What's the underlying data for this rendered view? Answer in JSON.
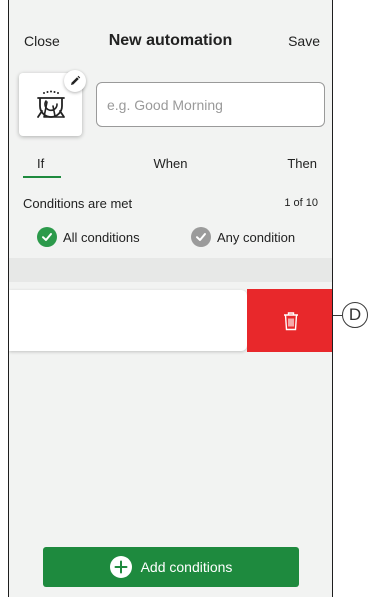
{
  "header": {
    "close_label": "Close",
    "title": "New automation",
    "save_label": "Save"
  },
  "automation": {
    "icon": "dishwasher-icon",
    "edit_icon": "pencil-icon",
    "name_placeholder": "e.g. Good Morning",
    "name_value": ""
  },
  "tabs": [
    {
      "label": "If",
      "active": true
    },
    {
      "label": "When",
      "active": false
    },
    {
      "label": "Then",
      "active": false
    }
  ],
  "conditions": {
    "label": "Conditions are met",
    "count": "1 of 10",
    "options": [
      {
        "label": "All conditions",
        "selected": true
      },
      {
        "label": "Any condition",
        "selected": false
      }
    ]
  },
  "swipe_row": {
    "delete_icon": "trash-icon"
  },
  "footer": {
    "add_label": "Add conditions"
  },
  "callout": {
    "letter": "D"
  },
  "colors": {
    "accent_green": "#1e8a3e",
    "radio_green": "#2c9a4b",
    "radio_grey": "#9b9b9b",
    "delete_red": "#e8282b",
    "background": "#f2f3f2"
  }
}
